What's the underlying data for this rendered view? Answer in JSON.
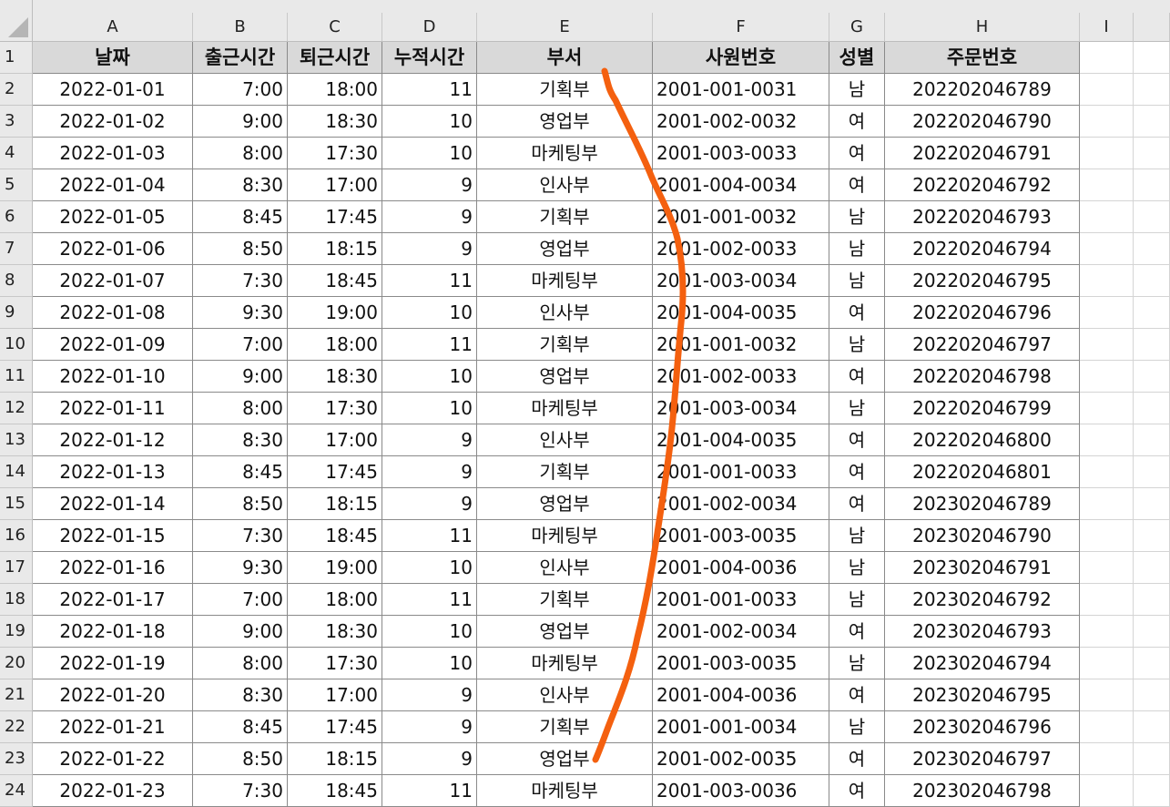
{
  "columns": [
    "A",
    "B",
    "C",
    "D",
    "E",
    "F",
    "G",
    "H",
    "I"
  ],
  "row_numbers": [
    "1",
    "2",
    "3",
    "4",
    "5",
    "6",
    "7",
    "8",
    "9",
    "10",
    "11",
    "12",
    "13",
    "14",
    "15",
    "16",
    "17",
    "18",
    "19",
    "20",
    "21",
    "22",
    "23",
    "24"
  ],
  "headers": [
    "날짜",
    "출근시간",
    "퇴근시간",
    "누적시간",
    "부서",
    "사원번호",
    "성별",
    "주문번호"
  ],
  "rows": [
    [
      "2022-01-01",
      "7:00",
      "18:00",
      "11",
      "기획부",
      "2001-001-0031",
      "남",
      "202202046789"
    ],
    [
      "2022-01-02",
      "9:00",
      "18:30",
      "10",
      "영업부",
      "2001-002-0032",
      "여",
      "202202046790"
    ],
    [
      "2022-01-03",
      "8:00",
      "17:30",
      "10",
      "마케팅부",
      "2001-003-0033",
      "여",
      "202202046791"
    ],
    [
      "2022-01-04",
      "8:30",
      "17:00",
      "9",
      "인사부",
      "2001-004-0034",
      "여",
      "202202046792"
    ],
    [
      "2022-01-05",
      "8:45",
      "17:45",
      "9",
      "기획부",
      "2001-001-0032",
      "남",
      "202202046793"
    ],
    [
      "2022-01-06",
      "8:50",
      "18:15",
      "9",
      "영업부",
      "2001-002-0033",
      "남",
      "202202046794"
    ],
    [
      "2022-01-07",
      "7:30",
      "18:45",
      "11",
      "마케팅부",
      "2001-003-0034",
      "남",
      "202202046795"
    ],
    [
      "2022-01-08",
      "9:30",
      "19:00",
      "10",
      "인사부",
      "2001-004-0035",
      "여",
      "202202046796"
    ],
    [
      "2022-01-09",
      "7:00",
      "18:00",
      "11",
      "기획부",
      "2001-001-0032",
      "남",
      "202202046797"
    ],
    [
      "2022-01-10",
      "9:00",
      "18:30",
      "10",
      "영업부",
      "2001-002-0033",
      "여",
      "202202046798"
    ],
    [
      "2022-01-11",
      "8:00",
      "17:30",
      "10",
      "마케팅부",
      "2001-003-0034",
      "남",
      "202202046799"
    ],
    [
      "2022-01-12",
      "8:30",
      "17:00",
      "9",
      "인사부",
      "2001-004-0035",
      "여",
      "202202046800"
    ],
    [
      "2022-01-13",
      "8:45",
      "17:45",
      "9",
      "기획부",
      "2001-001-0033",
      "여",
      "202202046801"
    ],
    [
      "2022-01-14",
      "8:50",
      "18:15",
      "9",
      "영업부",
      "2001-002-0034",
      "여",
      "202302046789"
    ],
    [
      "2022-01-15",
      "7:30",
      "18:45",
      "11",
      "마케팅부",
      "2001-003-0035",
      "남",
      "202302046790"
    ],
    [
      "2022-01-16",
      "9:30",
      "19:00",
      "10",
      "인사부",
      "2001-004-0036",
      "남",
      "202302046791"
    ],
    [
      "2022-01-17",
      "7:00",
      "18:00",
      "11",
      "기획부",
      "2001-001-0033",
      "남",
      "202302046792"
    ],
    [
      "2022-01-18",
      "9:00",
      "18:30",
      "10",
      "영업부",
      "2001-002-0034",
      "여",
      "202302046793"
    ],
    [
      "2022-01-19",
      "8:00",
      "17:30",
      "10",
      "마케팅부",
      "2001-003-0035",
      "남",
      "202302046794"
    ],
    [
      "2022-01-20",
      "8:30",
      "17:00",
      "9",
      "인사부",
      "2001-004-0036",
      "여",
      "202302046795"
    ],
    [
      "2022-01-21",
      "8:45",
      "17:45",
      "9",
      "기획부",
      "2001-001-0034",
      "남",
      "202302046796"
    ],
    [
      "2022-01-22",
      "8:50",
      "18:15",
      "9",
      "영업부",
      "2001-002-0035",
      "여",
      "202302046797"
    ],
    [
      "2022-01-23",
      "7:30",
      "18:45",
      "11",
      "마케팅부",
      "2001-003-0036",
      "여",
      "202302046798"
    ]
  ],
  "marker_color": "#f4600f"
}
